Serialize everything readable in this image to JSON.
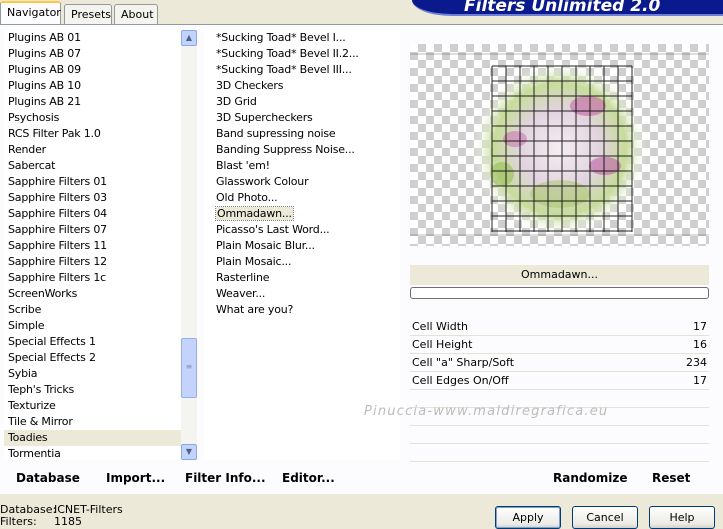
{
  "tabs": [
    {
      "label": "Navigator",
      "active": true
    },
    {
      "label": "Presets",
      "active": false
    },
    {
      "label": "About",
      "active": false
    }
  ],
  "banner_title": "Filters Unlimited 2.0",
  "categories": [
    "Plugins AB 01",
    "Plugins AB 07",
    "Plugins AB 09",
    "Plugins AB 10",
    "Plugins AB 21",
    "Psychosis",
    "RCS Filter Pak 1.0",
    "Render",
    "Sabercat",
    "Sapphire Filters 01",
    "Sapphire Filters 03",
    "Sapphire Filters 04",
    "Sapphire Filters 07",
    "Sapphire Filters 11",
    "Sapphire Filters 12",
    "Sapphire Filters 1c",
    "ScreenWorks",
    "Scribe",
    "Simple",
    "Special Effects 1",
    "Special Effects 2",
    "Sybia",
    "Teph's Tricks",
    "Texturize",
    "Tile & Mirror",
    "Toadies",
    "Tormentia"
  ],
  "selected_category": "Toadies",
  "filters": [
    "*Sucking Toad*  Bevel I...",
    "*Sucking Toad*  Bevel II.2...",
    "*Sucking Toad*  Bevel III...",
    "3D Checkers",
    "3D Grid",
    "3D Supercheckers",
    "Band supressing noise",
    "Banding Suppress Noise...",
    "Blast 'em!",
    "Glasswork Colour",
    "Old Photo...",
    "Ommadawn...",
    "Picasso's Last Word...",
    "Plain Mosaic Blur...",
    "Plain Mosaic...",
    "Rasterline",
    "Weaver...",
    "What are you?"
  ],
  "selected_filter": "Ommadawn...",
  "current_filter_name": "Ommadawn...",
  "progress": 0,
  "params": [
    {
      "label": "Cell Width",
      "value": "17"
    },
    {
      "label": "Cell Height",
      "value": "16"
    },
    {
      "label": "Cell \"a\" Sharp/Soft",
      "value": "234"
    },
    {
      "label": "Cell Edges On/Off",
      "value": "17"
    }
  ],
  "watermark": "Pinuccia-www.maldiregrafica.eu",
  "bottom_buttons": {
    "database": "Database",
    "import": "Import...",
    "filter_info": "Filter Info...",
    "editor": "Editor...",
    "randomize": "Randomize",
    "reset": "Reset"
  },
  "status": {
    "database_label": "Database:",
    "database_value": "ICNET-Filters",
    "filters_label": "Filters:",
    "filters_value": "1185"
  },
  "dialog_buttons": {
    "apply": "Apply",
    "cancel": "Cancel",
    "help": "Help"
  },
  "colors": {
    "banner": "#0a1a8c",
    "panel": "#ece9d8",
    "accent": "#ffc83c"
  }
}
